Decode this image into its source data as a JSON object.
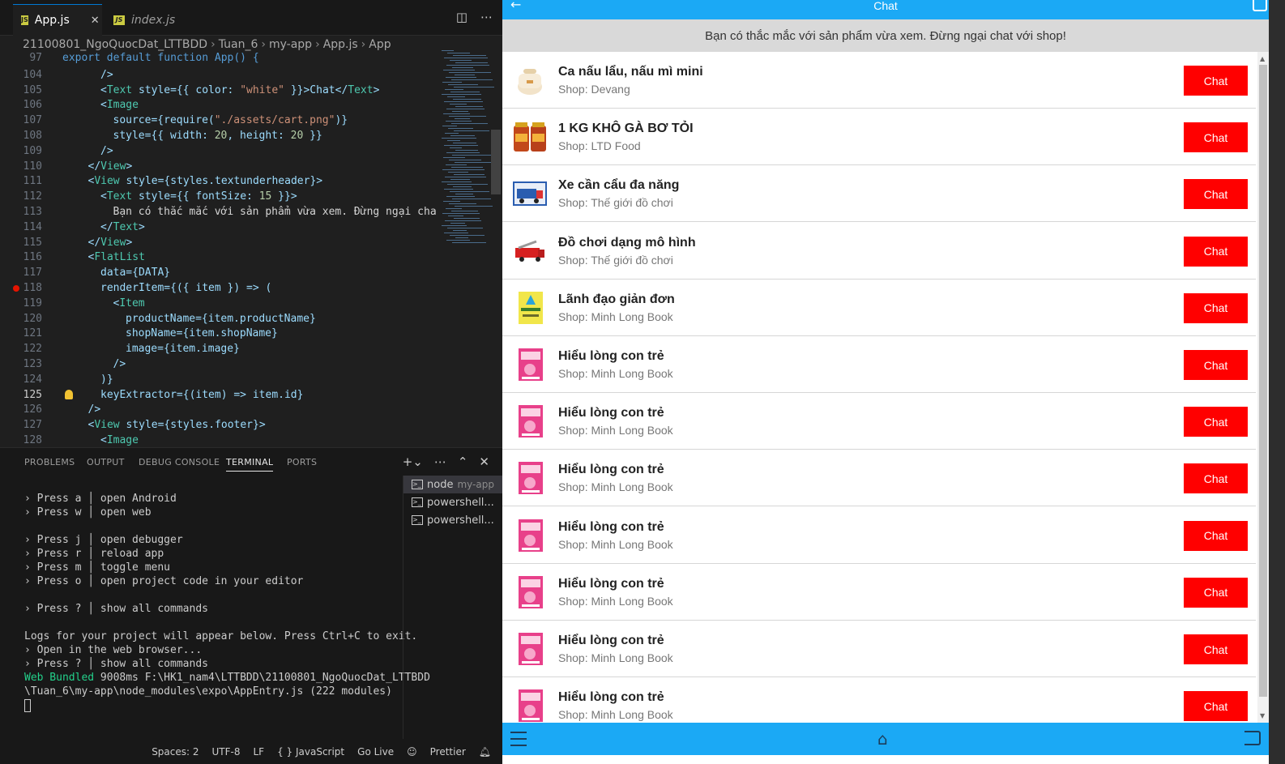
{
  "editor": {
    "tabs": [
      {
        "label": "App.js",
        "close": "✕"
      },
      {
        "label": "index.js"
      }
    ],
    "breadcrumb": [
      "21100801_NgoQuocDat_LTTBDD",
      "Tuan_6",
      "my-app",
      "App.js",
      "App"
    ],
    "code": [
      {
        "num": "97",
        "text": "export default function App() {"
      },
      {
        "num": "104",
        "text": "/>"
      },
      {
        "num": "105",
        "text": "<Text style={{ color: \"white\" }}>Chat</Text>"
      },
      {
        "num": "106",
        "text": "<Image"
      },
      {
        "num": "107",
        "text": "source={require(\"./assets/cart.png\")}"
      },
      {
        "num": "108",
        "text": "style={{ width: 20, height: 20 }}"
      },
      {
        "num": "109",
        "text": "/>"
      },
      {
        "num": "110",
        "text": "</View>"
      },
      {
        "num": "111",
        "text": "<View style={styles.textunderheader}>"
      },
      {
        "num": "112",
        "text": "<Text style={{ fontSize: 15 }}>"
      },
      {
        "num": "113",
        "text": "Bạn có thắc mắc với sản phẩm vừa xem. Đừng ngại cha"
      },
      {
        "num": "114",
        "text": "</Text>"
      },
      {
        "num": "115",
        "text": "</View>"
      },
      {
        "num": "116",
        "text": "<FlatList"
      },
      {
        "num": "117",
        "text": "data={DATA}"
      },
      {
        "num": "118",
        "text": "renderItem={({ item }) => ("
      },
      {
        "num": "119",
        "text": "<Item"
      },
      {
        "num": "120",
        "text": "productName={item.productName}"
      },
      {
        "num": "121",
        "text": "shopName={item.shopName}"
      },
      {
        "num": "122",
        "text": "image={item.image}"
      },
      {
        "num": "123",
        "text": "/>"
      },
      {
        "num": "124",
        "text": ")}"
      },
      {
        "num": "125",
        "text": "keyExtractor={(item) => item.id}"
      },
      {
        "num": "126",
        "text": "/>"
      },
      {
        "num": "127",
        "text": "<View style={styles.footer}>"
      },
      {
        "num": "128",
        "text": "<Image"
      }
    ]
  },
  "panel": {
    "tabs": [
      "PROBLEMS",
      "OUTPUT",
      "DEBUG CONSOLE",
      "TERMINAL",
      "PORTS"
    ],
    "active_tab": "TERMINAL",
    "terminal_lines": [
      "› Press a │ open Android",
      "› Press w │ open web",
      "",
      "› Press j │ open debugger",
      "› Press r │ reload app",
      "› Press m │ toggle menu",
      "› Press o │ open project code in your editor",
      "",
      "› Press ? │ show all commands",
      "",
      "Logs for your project will appear below. Press Ctrl+C to exit.",
      "› Open in the web browser...",
      "› Press ? │ show all commands"
    ],
    "bundle_label": "Web Bundled",
    "bundle_rest": " 9008ms F:\\HK1_nam4\\LTTBDD\\21100801_NgoQuocDat_LTTBDD",
    "bundle_line2": "\\Tuan_6\\my-app\\node_modules\\expo\\AppEntry.js (222 modules)",
    "terminals": [
      {
        "name": "node",
        "sub": "my-app"
      },
      {
        "name": "powershell...",
        "sub": ""
      },
      {
        "name": "powershell...",
        "sub": ""
      }
    ]
  },
  "statusbar": [
    "Spaces: 2",
    "UTF-8",
    "LF",
    "{ } JavaScript",
    "Go Live",
    "Prettier"
  ],
  "app": {
    "title": "Chat",
    "subheader": "Bạn có thắc mắc với sản phẩm vừa xem. Đừng ngại chat với shop!",
    "chat_label": "Chat",
    "items": [
      {
        "name": "Ca nấu lẩu, nấu mì mini",
        "shop": "Shop: Devang",
        "thumb": "pot"
      },
      {
        "name": "1 KG KHÔ GÀ BƠ TỎI",
        "shop": "Shop: LTD Food",
        "thumb": "jar"
      },
      {
        "name": "Xe cần cẩu đa năng",
        "shop": "Shop: Thế giới đồ chơi",
        "thumb": "truck-box"
      },
      {
        "name": "Đồ chơi dạng mô hình",
        "shop": "Shop: Thế giới đồ chơi",
        "thumb": "fire-truck"
      },
      {
        "name": "Lãnh đạo giản đơn",
        "shop": "Shop: Minh Long Book",
        "thumb": "yellow-book"
      },
      {
        "name": "Hiểu lòng con trẻ",
        "shop": "Shop: Minh Long Book",
        "thumb": "pink-book"
      },
      {
        "name": "Hiểu lòng con trẻ",
        "shop": "Shop: Minh Long Book",
        "thumb": "pink-book"
      },
      {
        "name": "Hiểu lòng con trẻ",
        "shop": "Shop: Minh Long Book",
        "thumb": "pink-book"
      },
      {
        "name": "Hiểu lòng con trẻ",
        "shop": "Shop: Minh Long Book",
        "thumb": "pink-book"
      },
      {
        "name": "Hiểu lòng con trẻ",
        "shop": "Shop: Minh Long Book",
        "thumb": "pink-book"
      },
      {
        "name": "Hiểu lòng con trẻ",
        "shop": "Shop: Minh Long Book",
        "thumb": "pink-book"
      },
      {
        "name": "Hiểu lòng con trẻ",
        "shop": "Shop: Minh Long Book",
        "thumb": "pink-book"
      }
    ]
  }
}
